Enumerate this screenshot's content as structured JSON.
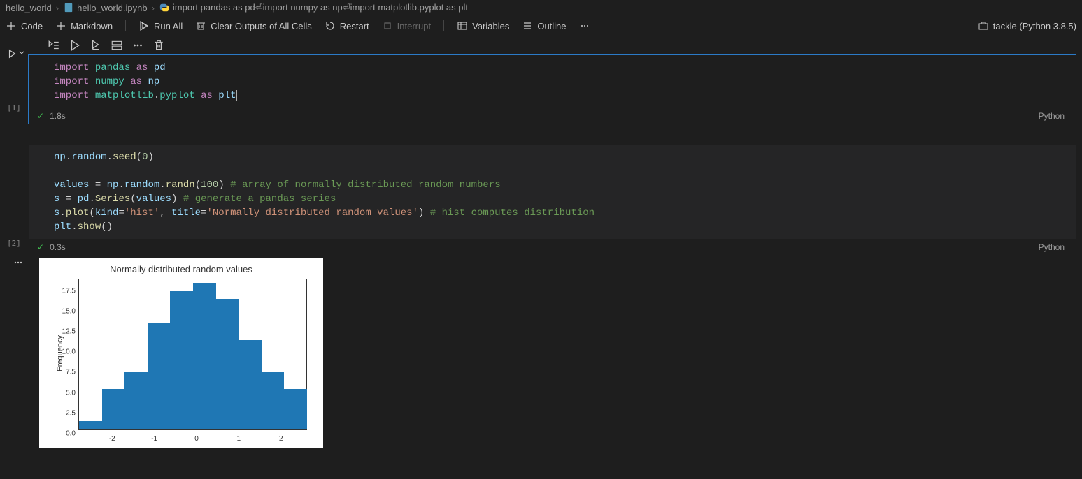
{
  "breadcrumb": {
    "root": "hello_world",
    "file": "hello_world.ipynb",
    "cell_summary": "import pandas as pd⏎import numpy as np⏎import matplotlib.pyplot as plt"
  },
  "toolbar": {
    "code": "Code",
    "markdown": "Markdown",
    "run_all": "Run All",
    "clear": "Clear Outputs of All Cells",
    "restart": "Restart",
    "interrupt": "Interrupt",
    "variables": "Variables",
    "outline": "Outline",
    "kernel": "tackle (Python 3.8.5)"
  },
  "cells": [
    {
      "exec_label": "[1]",
      "time": "1.8s",
      "lang": "Python",
      "code_html": "<span class='kw'>import</span> <span class='mod'>pandas</span> <span class='kw'>as</span> <span class='alias'>pd</span>\n<span class='kw'>import</span> <span class='mod'>numpy</span> <span class='kw'>as</span> <span class='alias'>np</span>\n<span class='kw'>import</span> <span class='mod'>matplotlib</span><span class='dot'>.</span><span class='mod'>pyplot</span> <span class='kw'>as</span> <span class='alias'>plt</span><span class='cursor'></span>"
    },
    {
      "exec_label": "[2]",
      "time": "0.3s",
      "lang": "Python",
      "code_html": "<span class='var'>np</span><span class='dot'>.</span><span class='var'>random</span><span class='dot'>.</span><span class='fn'>seed</span><span class='pn'>(</span><span class='num'>0</span><span class='pn'>)</span>\n\n<span class='var'>values</span> <span class='pn'>=</span> <span class='var'>np</span><span class='dot'>.</span><span class='var'>random</span><span class='dot'>.</span><span class='fn'>randn</span><span class='pn'>(</span><span class='num'>100</span><span class='pn'>)</span> <span class='cm'># array of normally distributed random numbers</span>\n<span class='var'>s</span> <span class='pn'>=</span> <span class='var'>pd</span><span class='dot'>.</span><span class='fn'>Series</span><span class='pn'>(</span><span class='var'>values</span><span class='pn'>)</span> <span class='cm'># generate a pandas series</span>\n<span class='var'>s</span><span class='dot'>.</span><span class='fn'>plot</span><span class='pn'>(</span><span class='var'>kind</span><span class='pn'>=</span><span class='str'>'hist'</span><span class='pn'>,</span> <span class='var'>title</span><span class='pn'>=</span><span class='str'>'Normally distributed random values'</span><span class='pn'>)</span> <span class='cm'># hist computes distribution</span>\n<span class='var'>plt</span><span class='dot'>.</span><span class='fn'>show</span><span class='pn'>()</span>"
    }
  ],
  "chart_data": {
    "type": "bar",
    "title": "Normally distributed random values",
    "ylabel": "Frequency",
    "xlabel": "",
    "x_ticks": [
      -2,
      -1,
      0,
      1,
      2
    ],
    "y_ticks": [
      0.0,
      2.5,
      5.0,
      7.5,
      10.0,
      12.5,
      15.0,
      17.5
    ],
    "x_range": [
      -2.8,
      2.6
    ],
    "y_range": [
      0,
      18.5
    ],
    "bin_edges": [
      -2.8,
      -2.26,
      -1.72,
      -1.18,
      -0.64,
      -0.1,
      0.44,
      0.98,
      1.52,
      2.06,
      2.6
    ],
    "values": [
      1,
      5,
      7,
      13,
      17,
      18,
      16,
      11,
      7,
      5
    ]
  }
}
